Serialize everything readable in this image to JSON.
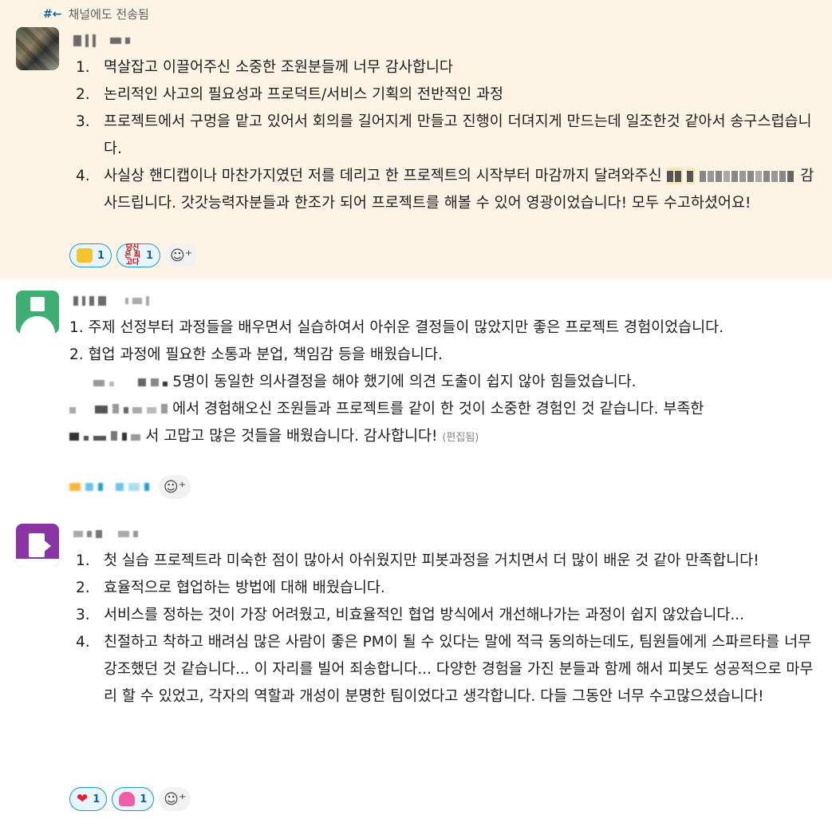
{
  "message1": {
    "forwarded_label": "채널에도 전송됨",
    "forwarded_icon": "hash-forward-icon",
    "items": [
      {
        "num": "1.",
        "text": "멱살잡고 이끌어주신 소중한 조원분들께 너무 감사합니다"
      },
      {
        "num": "2.",
        "text": "논리적인 사고의 필요성과 프로덕트/서비스 기획의 전반적인 과정"
      },
      {
        "num": "3.",
        "text": "프로젝트에서 구멍을 맡고 있어서 회의를 길어지게 만들고 진행이 더뎌지게 만드는데 일조한것 같아서 송구스럽습니다."
      },
      {
        "num": "4.",
        "text_before": "사실상 핸디캡이나 마찬가지였던 저를 데리고 한 프로젝트의 시작부터 마감까지 달려와주신",
        "text_after": "감사드립니다. 갓갓능력자분들과 한조가 되어 프로젝트를 해볼 수 있어 영광이었습니다! 모두 수고하셨어요!"
      }
    ],
    "reactions": [
      {
        "icon": "yellow-face-emoji-icon",
        "count": "1"
      },
      {
        "icon": "dangsin-eun-choego-da-emoji-icon",
        "emoji_text": "당신은 최고다",
        "count": "1"
      }
    ],
    "add_reaction_icon": "add-reaction-icon"
  },
  "message2": {
    "lines": [
      "1. 주제 선정부터 과정들을 배우면서 실습하여서 아쉬운 결정들이 많았지만 좋은 프로젝트 경험이었습니다.",
      "2. 협업 과정에 필요한 소통과 분업, 책임감 등을 배웠습니다."
    ],
    "line3_tail": "5명이 동일한 의사결정을 해야 했기에 의견 도출이 쉽지 않아 힘들었습니다.",
    "line4_tail": "에서 경험해오신 조원들과 프로젝트를 같이 한 것이 소중한 경험인 것 같습니다. 부족한",
    "line5_tail": "서 고맙고 많은 것들을 배웠습니다. 감사합니다!",
    "edited_label": "(편집됨)",
    "add_reaction_icon": "add-reaction-icon"
  },
  "message3": {
    "items": [
      {
        "num": "1.",
        "text": "첫 실습 프로젝트라 미숙한 점이 많아서 아쉬웠지만 피봇과정을 거치면서 더 많이 배운 것 같아 만족합니다!"
      },
      {
        "num": "2.",
        "text": "효율적으로 협업하는 방법에 대해 배웠습니다."
      },
      {
        "num": "3.",
        "text": "서비스를 정하는 것이 가장 어려웠고, 비효율적인 협업 방식에서 개선해나가는 과정이 쉽지 않았습니다..."
      },
      {
        "num": "4.",
        "text": "친절하고 착하고 배려심 많은 사람이 좋은 PM이 될 수 있다는 말에 적극 동의하는데도, 팀원들에게 스파르타를 너무 강조했던 것 같습니다... 이 자리를 빌어 죄송합니다... 다양한 경험을 가진 분들과 함께 해서 피봇도 성공적으로 마무리 할 수 있었고, 각자의 역할과 개성이 분명한 팀이었다고 생각합니다. 다들 그동안 너무 수고많으셨습니다!"
      }
    ],
    "reactions": [
      {
        "icon": "red-heart-emoji-icon",
        "count": "1"
      },
      {
        "icon": "pink-blob-emoji-icon",
        "count": "1"
      }
    ],
    "add_reaction_icon": "add-reaction-icon"
  }
}
